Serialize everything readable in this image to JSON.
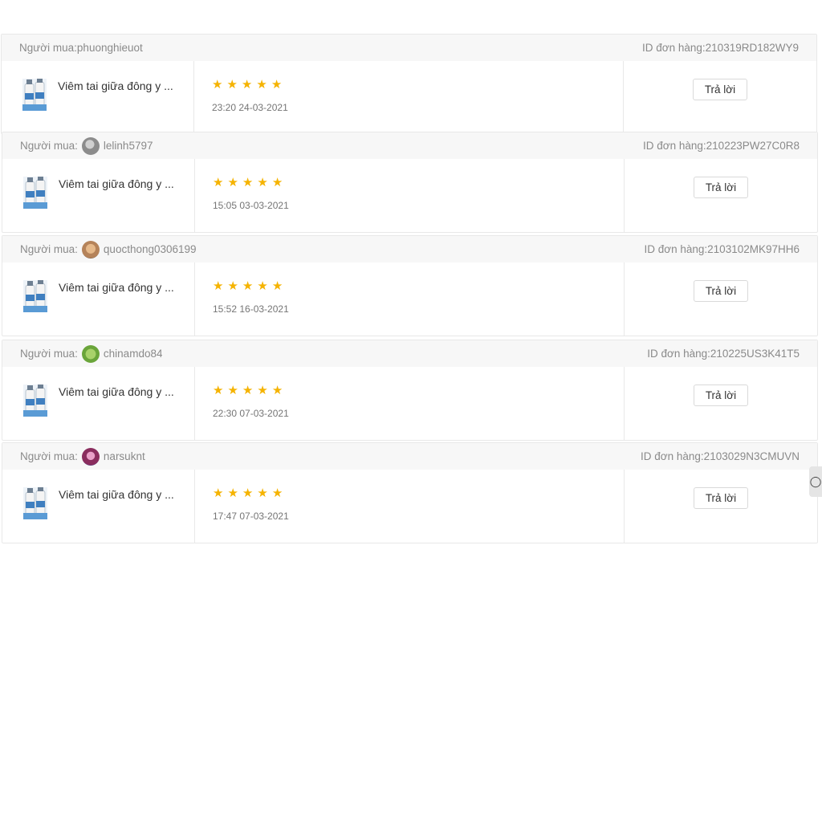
{
  "reviews": [
    {
      "buyer_label": "Người mua:",
      "buyer_name": "phuonghieuot",
      "order_id": "ID đơn hàng:210319RD182WY9",
      "product_name": "Viêm tai giữa đông y ...",
      "rating": 5,
      "date": "23:20 24-03-2021",
      "reply_label": "Trả lời",
      "avatar_color": ""
    },
    {
      "buyer_label": "Người mua:",
      "buyer_name": "lelinh5797",
      "order_id": "ID đơn hàng:210223PW27C0R8",
      "product_name": "Viêm tai giữa đông y ...",
      "rating": 5,
      "date": "15:05 03-03-2021",
      "reply_label": "Trả lời",
      "avatar_color": "#8c8c8c"
    },
    {
      "buyer_label": "Người mua:",
      "buyer_name": "quocthong0306199",
      "order_id": "ID đơn hàng:2103102MK97HH6",
      "product_name": "Viêm tai giữa đông y ...",
      "rating": 5,
      "date": "15:52 16-03-2021",
      "reply_label": "Trả lời",
      "avatar_color": "#b5835a"
    },
    {
      "buyer_label": "Người mua:",
      "buyer_name": "chinamdo84",
      "order_id": "ID đơn hàng:210225US3K41T5",
      "product_name": "Viêm tai giữa đông y ...",
      "rating": 5,
      "date": "22:30 07-03-2021",
      "reply_label": "Trả lời",
      "avatar_color": "#6aa53a"
    },
    {
      "buyer_label": "Người mua:",
      "buyer_name": "narsuknt",
      "order_id": "ID đơn hàng:2103029N3CMUVN",
      "product_name": "Viêm tai giữa đông y ...",
      "rating": 5,
      "date": "17:47 07-03-2021",
      "reply_label": "Trả lời",
      "avatar_color": "#8a2d5e"
    }
  ],
  "colors": {
    "star": "#f5b301",
    "header_bg": "#f7f7f7",
    "border": "#e8e8e8"
  },
  "side_tab_icon": "chat-icon"
}
